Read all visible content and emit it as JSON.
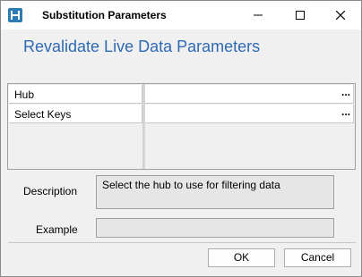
{
  "window": {
    "title": "Substitution Parameters",
    "app_icon": "app-h-icon",
    "controls": [
      "minimize-icon",
      "maximize-icon",
      "close-icon"
    ]
  },
  "main": {
    "heading": "Revalidate Live Data Parameters"
  },
  "grid": {
    "rows": [
      {
        "name": "Hub",
        "value": "",
        "browse": "..."
      },
      {
        "name": "Select Keys",
        "value": "",
        "browse": "..."
      }
    ]
  },
  "description": {
    "label": "Description",
    "text": "Select the hub to use for filtering data"
  },
  "example": {
    "label": "Example",
    "text": ""
  },
  "buttons": {
    "ok": "OK",
    "cancel": "Cancel"
  },
  "colors": {
    "accent": "#2e6ab3",
    "app_icon": "#2c7bb6"
  }
}
